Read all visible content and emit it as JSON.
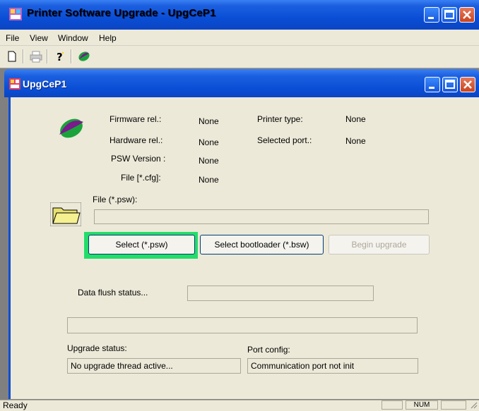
{
  "window": {
    "title": "Printer Software Upgrade - UpgCeP1",
    "title_icon": "printer-upgrade-app-icon"
  },
  "menu": [
    "File",
    "View",
    "Window",
    "Help"
  ],
  "toolbar": {
    "buttons": [
      "new-document-icon",
      "print-icon",
      "help-pointer-icon",
      "app-logo-icon"
    ]
  },
  "child_window": {
    "title": "UpgCeP1"
  },
  "info": {
    "firmware_label": "Firmware rel.:",
    "firmware_value": "None",
    "hardware_label": "Hardware rel.:",
    "hardware_value": "None",
    "psw_label": "PSW Version :",
    "psw_value": "None",
    "cfg_label": "File [*.cfg]:",
    "cfg_value": "None",
    "printer_type_label": "Printer type:",
    "printer_type_value": "None",
    "port_label": "Selected port.:",
    "port_value": "None"
  },
  "file": {
    "label": "File (*.psw):",
    "value": ""
  },
  "buttons": {
    "select_psw": "Select (*.psw)",
    "select_bootloader": "Select bootloader (*.bsw)",
    "begin_upgrade": "Begin upgrade"
  },
  "flush": {
    "label": "Data flush status...",
    "value": ""
  },
  "progress": {
    "value": 0
  },
  "status": {
    "upgrade_label": "Upgrade status:",
    "upgrade_value": "No upgrade thread active...",
    "port_label": "Port config:",
    "port_value": "Communication port not init"
  },
  "statusbar": {
    "text": "Ready",
    "num": "NUM"
  },
  "colors": {
    "titlebar": "#0a4ed6",
    "highlight": "#22dd6a",
    "face": "#ece9d8"
  }
}
